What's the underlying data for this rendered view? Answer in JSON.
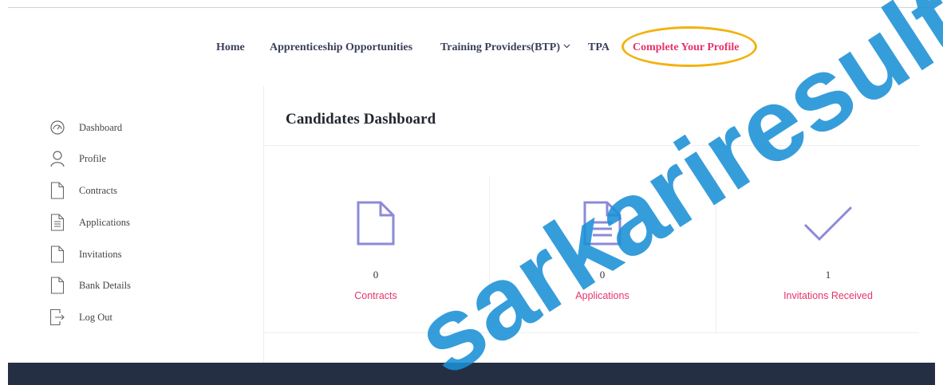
{
  "nav": {
    "items": [
      {
        "label": "Home"
      },
      {
        "label": "Apprenticeship Opportunities"
      },
      {
        "label": "Training Providers(BTP)"
      },
      {
        "label": "TPA"
      },
      {
        "label": "Complete Your Profile"
      }
    ]
  },
  "sidebar": {
    "items": [
      {
        "label": "Dashboard",
        "icon": "speedometer-icon"
      },
      {
        "label": "Profile",
        "icon": "user-icon"
      },
      {
        "label": "Contracts",
        "icon": "document-icon"
      },
      {
        "label": "Applications",
        "icon": "document-lines-icon"
      },
      {
        "label": "Invitations",
        "icon": "document-icon"
      },
      {
        "label": "Bank Details",
        "icon": "document-icon"
      },
      {
        "label": "Log Out",
        "icon": "logout-icon"
      }
    ]
  },
  "main": {
    "title": "Candidates Dashboard",
    "cards": [
      {
        "count": "0",
        "label": "Contracts",
        "icon": "document-icon"
      },
      {
        "count": "0",
        "label": "Applications",
        "icon": "document-lines-icon"
      },
      {
        "count": "1",
        "label": "Invitations Received",
        "icon": "checkmark-icon"
      }
    ]
  },
  "watermark": {
    "text": "sarkariresult.naukarti.in"
  },
  "colors": {
    "accent": "#e8336a",
    "icon_purple": "#8c8ad8",
    "highlight": "#f2b20c",
    "footer": "#252f44",
    "watermark": "#1a8fd6"
  }
}
